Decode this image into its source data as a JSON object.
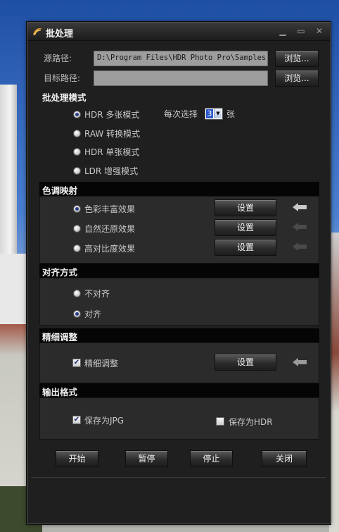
{
  "window": {
    "title": "批处理",
    "minimize_icon": "minimize-icon",
    "restore_icon": "restore-icon",
    "close_icon": "close-icon"
  },
  "paths": {
    "source_label": "源路径:",
    "source_value": "D:\\Program Files\\HDR Photo Pro\\Samples",
    "source_browse": "浏览...",
    "target_label": "目标路径:",
    "target_value": "",
    "target_browse": "浏览..."
  },
  "batch_mode": {
    "title": "批处理模式",
    "options": [
      {
        "label": "HDR 多张模式",
        "selected": true
      },
      {
        "label": "RAW 转换模式",
        "selected": false
      },
      {
        "label": "HDR 单张模式",
        "selected": false
      },
      {
        "label": "LDR 增强模式",
        "selected": false
      }
    ],
    "per_select_label": "每次选择",
    "per_select_value": "3",
    "per_select_unit": "张"
  },
  "tone_mapping": {
    "title": "色调映射",
    "options": [
      {
        "label": "色彩丰富效果",
        "selected": true,
        "button": "设置"
      },
      {
        "label": "自然还原效果",
        "selected": false,
        "button": "设置"
      },
      {
        "label": "高对比度效果",
        "selected": false,
        "button": "设置"
      }
    ]
  },
  "alignment": {
    "title": "对齐方式",
    "options": [
      {
        "label": "不对齐",
        "selected": false
      },
      {
        "label": "对齐",
        "selected": true
      }
    ]
  },
  "fine_tune": {
    "title": "精细调整",
    "checkbox_label": "精细调整",
    "checked": true,
    "button": "设置"
  },
  "output": {
    "title": "输出格式",
    "save_jpg_label": "保存为JPG",
    "save_jpg_checked": true,
    "save_hdr_label": "保存为HDR",
    "save_hdr_checked": false
  },
  "actions": {
    "start": "开始",
    "pause": "暂停",
    "stop": "停止",
    "close": "关闭"
  },
  "colors": {
    "window_bg": "#1f1f1f",
    "panel_bg": "#2b2b2b",
    "header_bg": "#050505",
    "field_bg": "#9d9d9d",
    "radio_dot": "#2a3c88"
  }
}
